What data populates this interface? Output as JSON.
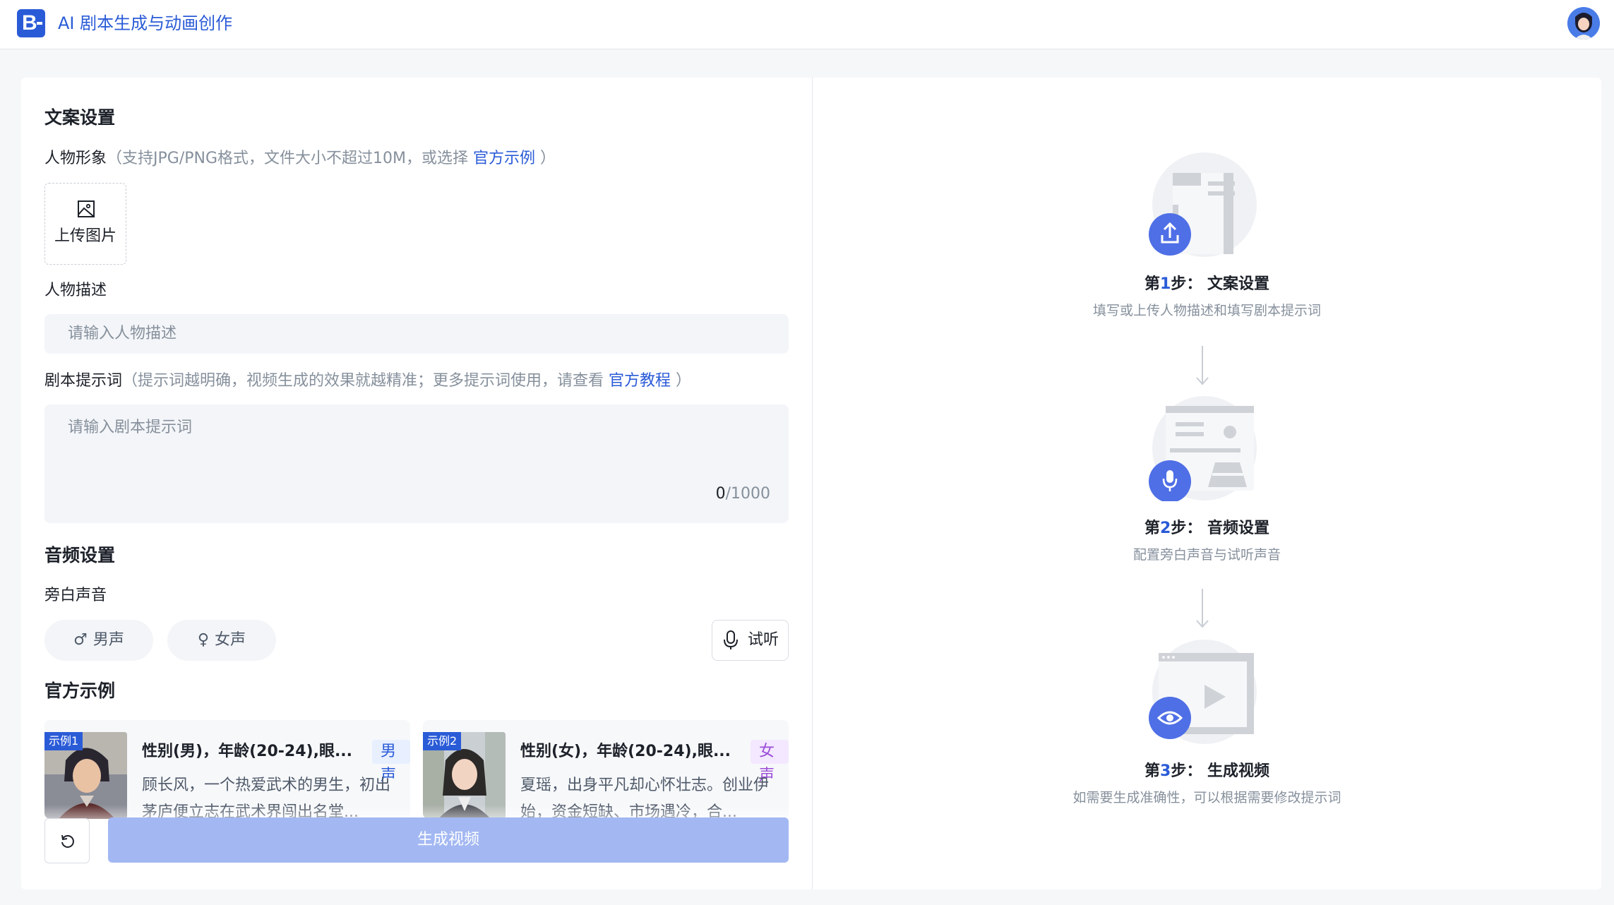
{
  "header": {
    "logo_letter": "B",
    "title": "AI 剧本生成与动画创作"
  },
  "copy_settings": {
    "title": "文案设置",
    "avatar_label": "人物形象",
    "avatar_hint": "（支持JPG/PNG格式，文件大小不超过10M，或选择",
    "avatar_link": "官方示例",
    "avatar_hint_end": "）",
    "upload_label": "上传图片",
    "desc_label": "人物描述",
    "desc_placeholder": "请输入人物描述",
    "prompt_label": "剧本提示词",
    "prompt_hint": "（提示词越明确，视频生成的效果就越精准；更多提示词使用，请查看",
    "prompt_link": "官方教程",
    "prompt_hint_end": "）",
    "prompt_placeholder": "请输入剧本提示词",
    "counter_current": "0",
    "counter_max": "/1000"
  },
  "audio_settings": {
    "title": "音频设置",
    "narration_label": "旁白声音",
    "male_symbol": "♂",
    "male_label": "男声",
    "female_symbol": "♀",
    "female_label": "女声",
    "listen_label": "试听"
  },
  "examples": {
    "title": "官方示例",
    "items": [
      {
        "tag": "示例1",
        "title": "性别(男)，年龄(20-24),眼...",
        "badge": "男声",
        "desc": "顾长风，一个热爱武术的男生，初出茅庐便立志在武术界闯出名堂..."
      },
      {
        "tag": "示例2",
        "title": "性别(女)，年龄(20-24),眼...",
        "badge": "女声",
        "desc": "夏瑶，出身平凡却心怀壮志。创业伊始，资金短缺、市场遇冷，合..."
      }
    ]
  },
  "actions": {
    "generate_label": "生成视频"
  },
  "steps": [
    {
      "prefix": "第",
      "num": "1",
      "suffix": "步：  文案设置",
      "desc": "填写或上传人物描述和填写剧本提示词"
    },
    {
      "prefix": "第",
      "num": "2",
      "suffix": "步：  音频设置",
      "desc": "配置旁白声音与试听声音"
    },
    {
      "prefix": "第",
      "num": "3",
      "suffix": "步：  生成视频",
      "desc": "如需要生成准确性，可以根据需要修改提示词"
    }
  ],
  "colors": {
    "brand": "#2a5bd7",
    "male_badge_bg": "#e8efff",
    "male_badge_text": "#2a5bd7",
    "female_badge_bg": "#f3e8ff",
    "female_badge_text": "#9b4dd9",
    "generate_button": "#a3b8f3"
  }
}
